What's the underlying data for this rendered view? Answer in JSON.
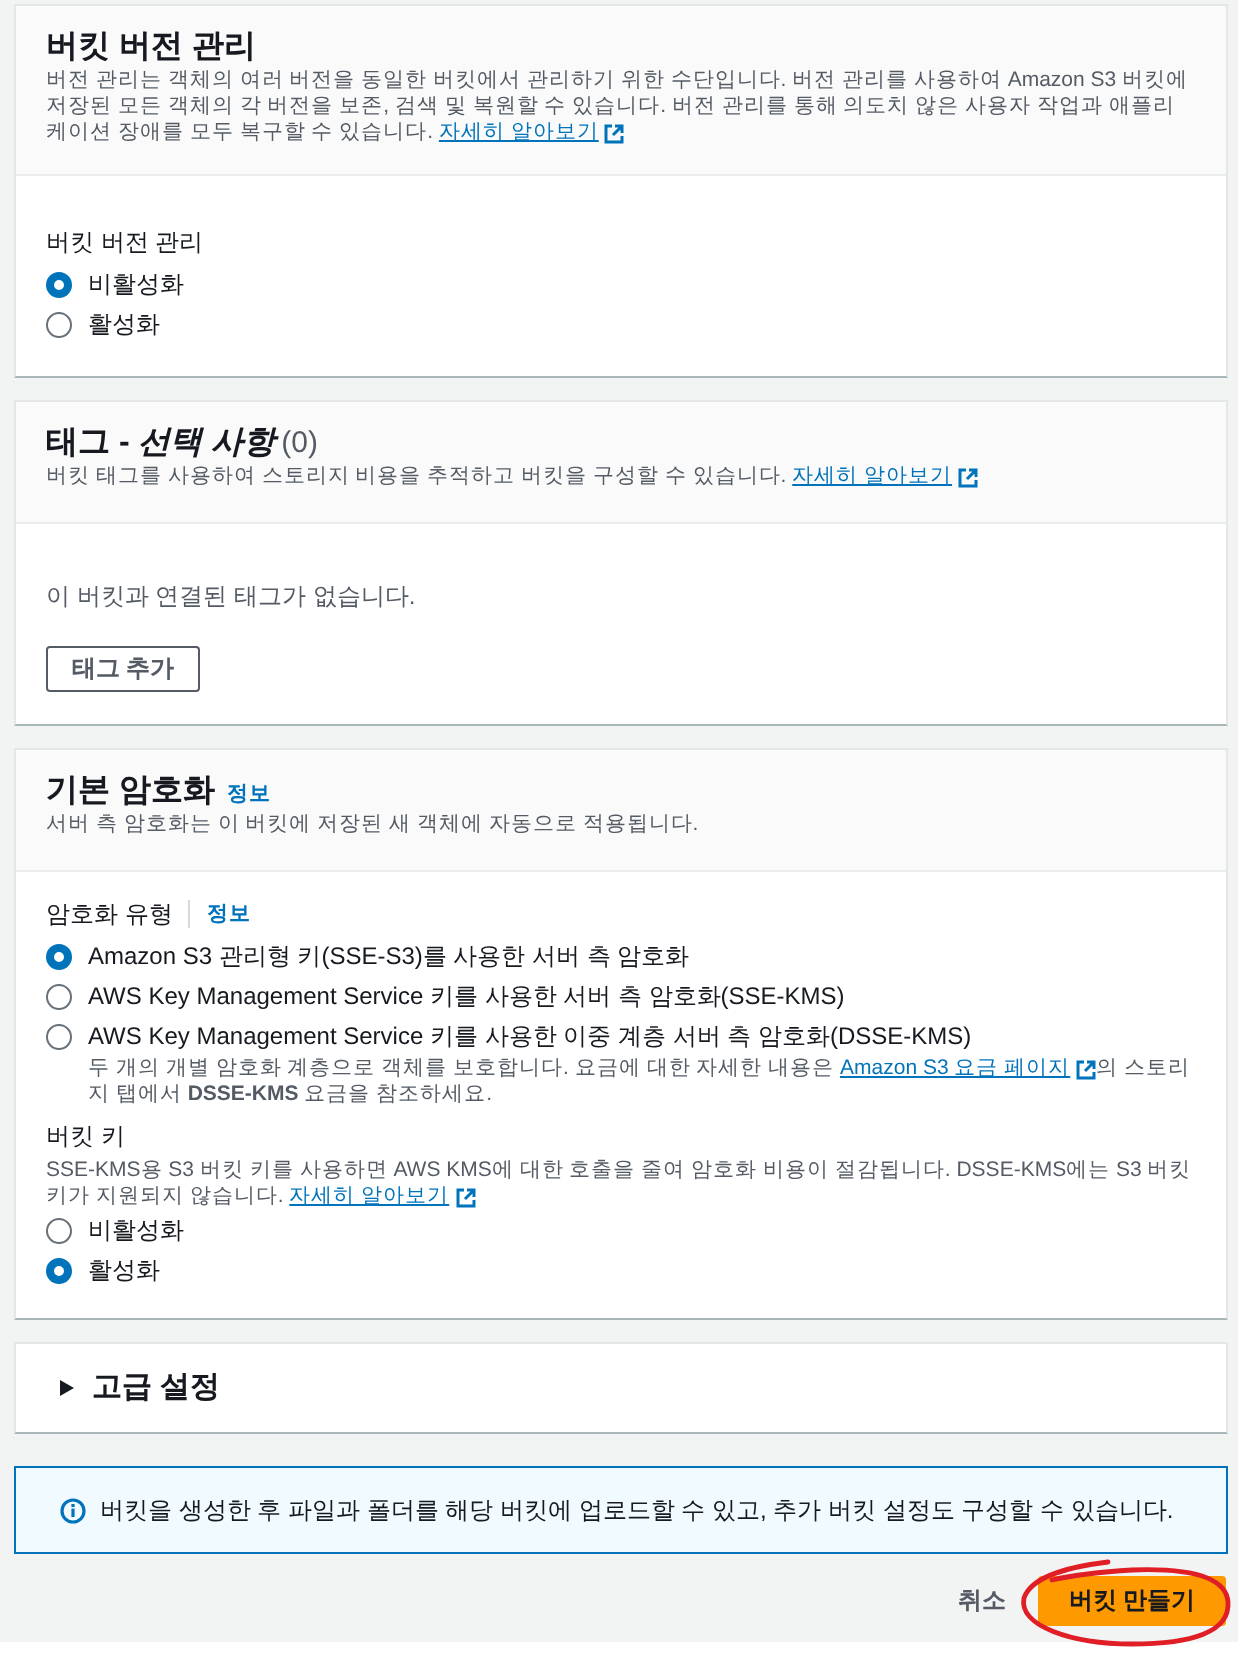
{
  "versioning": {
    "title": "버킷 버전 관리",
    "description": "버전 관리는 객체의 여러 버전을 동일한 버킷에서 관리하기 위한 수단입니다. 버전 관리를 사용하여 Amazon S3 버킷에 저장된 모든 객체의 각 버전을 보존, 검색 및 복원할 수 있습니다. 버전 관리를 통해 의도치 않은 사용자 작업과 애플리케이션 장애를 모두 복구할 수 있습니다.",
    "learn_more": "자세히 알아보기",
    "field_label": "버킷 버전 관리",
    "options": [
      {
        "label": "비활성화",
        "selected": true
      },
      {
        "label": "활성화",
        "selected": false
      }
    ]
  },
  "tags": {
    "title": "태그 - *선택 사항*",
    "count": "(0)",
    "description": "버킷 태그를 사용하여 스토리지 비용을 추적하고 버킷을 구성할 수 있습니다.",
    "learn_more": "자세히 알아보기",
    "empty_text": "이 버킷과 연결된 태그가 없습니다.",
    "add_button": "태그 추가"
  },
  "encryption": {
    "title": "기본 암호화",
    "info": "정보",
    "description": "서버 측 암호화는 이 버킷에 저장된 새 객체에 자동으로 적용됩니다.",
    "type_label": "암호화 유형",
    "type_info": "정보",
    "options": [
      {
        "label": "Amazon S3 관리형 키(SSE-S3)를 사용한 서버 측 암호화",
        "selected": true
      },
      {
        "label": "AWS Key Management Service 키를 사용한 서버 측 암호화(SSE-KMS)",
        "selected": false
      },
      {
        "label": "AWS Key Management Service 키를 사용한 이중 계층 서버 측 암호화(DSSE-KMS)",
        "selected": false,
        "note": {
          "before": "두 개의 개별 암호화 계층으로 객체를 보호합니다. 요금에 대한 자세한 내용은 ",
          "link": "Amazon S3 요금 페이지",
          "after": "의 스토리지 탭에서 **DSSE-KMS** 요금을 참조하세요."
        }
      }
    ],
    "bucket_key": {
      "label": "버킷 키",
      "description": "SSE-KMS용 S3 버킷 키를 사용하면 AWS KMS에 대한 호출을 줄여 암호화 비용이 절감됩니다. DSSE-KMS에는 S3 버킷 키가 지원되지 않습니다.",
      "learn_more": "자세히 알아보기",
      "options": [
        {
          "label": "비활성화",
          "selected": false
        },
        {
          "label": "활성화",
          "selected": true
        }
      ]
    }
  },
  "advanced": {
    "title": "고급 설정",
    "expanded": false
  },
  "alert": {
    "text": "버킷을 생성한 후 파일과 폴더를 해당 버킷에 업로드할 수 있고, 추가 버킷 설정도 구성할 수 있습니다."
  },
  "footer": {
    "cancel": "취소",
    "create": "버킷 만들기"
  }
}
